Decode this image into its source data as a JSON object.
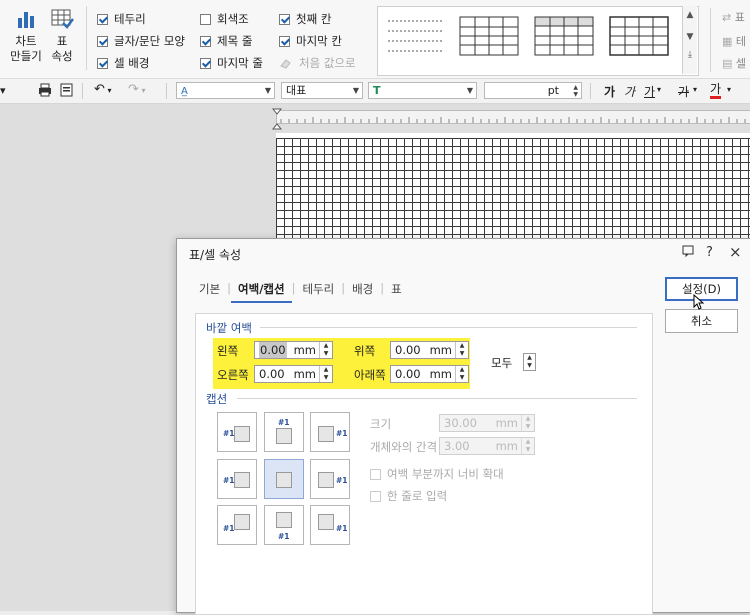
{
  "ribbon": {
    "chart_btn": {
      "line1": "차트",
      "line2": "만들기"
    },
    "table_btn": {
      "line1": "표",
      "line2": "속성"
    },
    "checks": [
      {
        "label": "테두리",
        "checked": true
      },
      {
        "label": "글자/문단 모양",
        "checked": true
      },
      {
        "label": "셀 배경",
        "checked": true
      },
      {
        "label": "회색조",
        "checked": false
      },
      {
        "label": "제목 줄",
        "checked": true
      },
      {
        "label": "마지막 줄",
        "checked": true
      },
      {
        "label": "첫째 칸",
        "checked": true
      },
      {
        "label": "마지막 칸",
        "checked": true
      },
      {
        "label": "처음 값으로",
        "checked": false
      }
    ],
    "right_items": [
      "표",
      "테",
      "셀"
    ]
  },
  "toolbar": {
    "style_value": "",
    "font_value": "대표",
    "font_face": "",
    "size_unit": "pt",
    "fmt_bold": "가",
    "fmt_italic": "가",
    "fmt_under": "가",
    "fmt_strike": "가",
    "fmt_color": "가"
  },
  "dialog": {
    "title": "표/셀 속성",
    "help_icon": "?",
    "close_icon": "×",
    "tabs": [
      "기본",
      "여백/캡션",
      "테두리",
      "배경",
      "표"
    ],
    "active_tab": "여백/캡션",
    "outer_margin": {
      "title": "바깥 여백",
      "left_label": "왼쪽",
      "left_value": "0.00",
      "right_label": "오른쪽",
      "right_value": "0.00",
      "top_label": "위쪽",
      "top_value": "0.00",
      "bottom_label": "아래쪽",
      "bottom_value": "0.00",
      "unit": "mm",
      "all_label": "모두"
    },
    "caption": {
      "title": "캡션",
      "size_label": "크기",
      "size_value": "30.00",
      "size_unit": "mm",
      "gap_label": "개체와의 간격",
      "gap_value": "3.00",
      "gap_unit": "mm",
      "expand_label": "여백 부분까지 너비 확대",
      "oneline_label": "한 줄로 입력",
      "position_tag": "#1"
    },
    "ok_label": "설정(D)",
    "cancel_label": "취소"
  }
}
